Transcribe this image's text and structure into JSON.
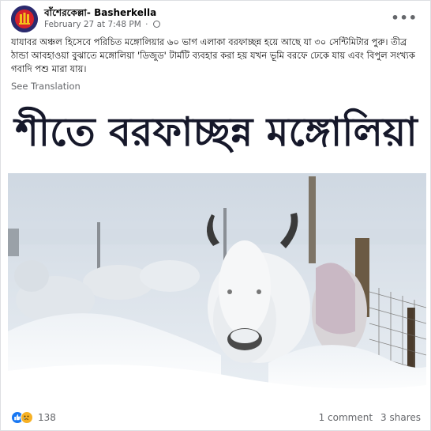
{
  "post": {
    "page_name": "বাঁশেরকেল্লা- Basherkella",
    "date": "February 27 at 7:48 PM",
    "separator": "·",
    "text": "যাযাবর অঞ্চল হিসেবে পরিচিত মঙ্গোলিয়ার ৬০ ভাগ এলাকা বরফাচ্ছন্ন হয়ে আছে যা ৩০ সেন্টিমিটার পুরু। তীব্র ঠান্ডা আবহাওয়া বুঝাতে মঙ্গোলিয়া 'ডিজুড' টার্মটি ব্যবহার করা হয় যখন ভূমি বরফে ঢেকে যায় এবং বিপুল সংখ্যক গবাদি পশু মারা যায়।",
    "see_translation": "See Translation",
    "image_headline": "শীতে বরফাচ্ছন্ন মঙ্গোলিয়া",
    "more_icon": "•••"
  },
  "footer": {
    "reaction_count": "138",
    "comments": "1 comment",
    "shares": "3 shares"
  },
  "colors": {
    "secondary_text": "#65676b",
    "like_blue": "#1877f2",
    "sad_yellow": "#f7b125",
    "avatar_bg": "#2b2a6e"
  },
  "icons": {
    "more": "more-options-icon",
    "privacy": "globe-icon",
    "like": "like-reaction-icon",
    "sad": "sad-reaction-icon"
  }
}
